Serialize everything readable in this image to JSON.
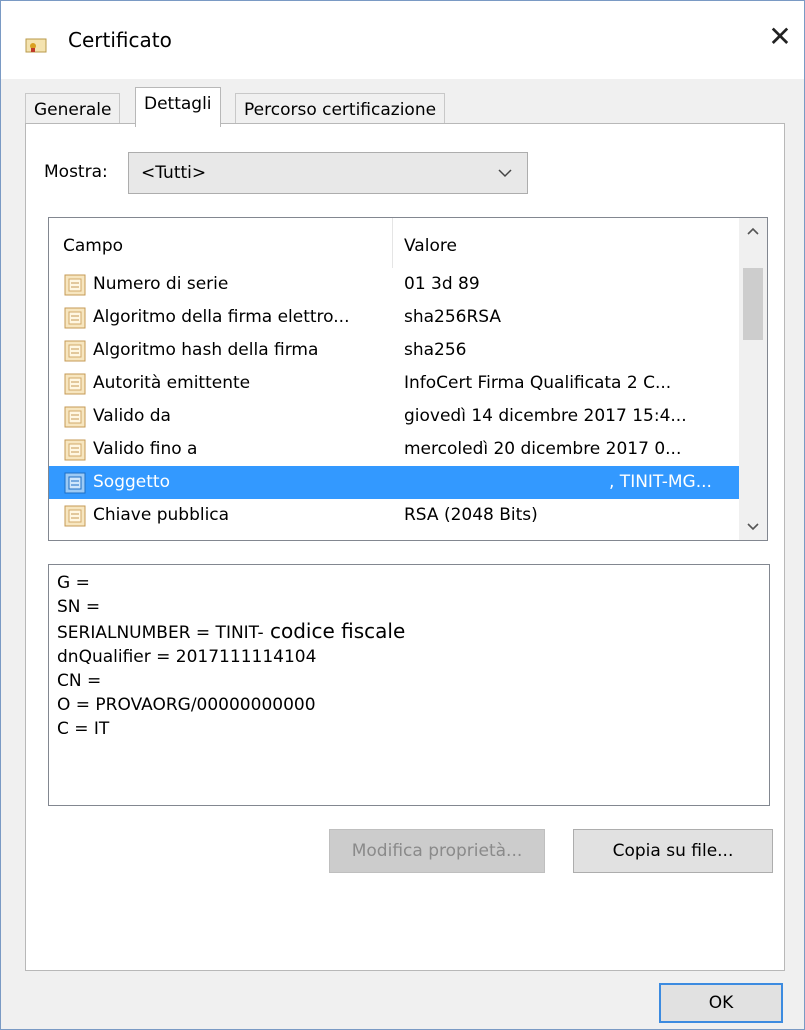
{
  "window": {
    "title": "Certificato",
    "close_glyph": "✕"
  },
  "tabs": [
    {
      "label": "Generale"
    },
    {
      "label": "Dettagli"
    },
    {
      "label": "Percorso certificazione"
    }
  ],
  "show": {
    "label": "Mostra:",
    "selected": "<Tutti>"
  },
  "list": {
    "headers": {
      "field": "Campo",
      "value": "Valore"
    },
    "rows": [
      {
        "field": "Numero di serie",
        "value": "01 3d 89"
      },
      {
        "field": "Algoritmo della firma elettro...",
        "value": "sha256RSA"
      },
      {
        "field": "Algoritmo hash della firma",
        "value": "sha256"
      },
      {
        "field": "Autorità emittente",
        "value": "InfoCert Firma Qualificata 2 C..."
      },
      {
        "field": "Valido da",
        "value": "giovedì 14 dicembre 2017 15:4..."
      },
      {
        "field": "Valido fino a",
        "value": "mercoledì 20 dicembre 2017 0..."
      },
      {
        "field": "Soggetto",
        "value": ", TINIT-MG..."
      },
      {
        "field": "Chiave pubblica",
        "value": "RSA (2048 Bits)"
      }
    ],
    "selected_index": 6
  },
  "detail": {
    "lines": [
      "G =",
      "SN =",
      "SERIALNUMBER = TINIT-",
      "dnQualifier = 2017111114104",
      "CN =",
      "O = PROVAORG/00000000000",
      "C = IT"
    ],
    "serial_suffix": " codice fiscale"
  },
  "buttons": {
    "edit_properties": "Modifica proprietà...",
    "copy_to_file": "Copia su file...",
    "ok": "OK"
  },
  "colors": {
    "selection": "#3399ff",
    "ok_border": "#3c8be0"
  },
  "icons": {
    "title": "certificate-icon",
    "row": "certificate-field-icon"
  }
}
